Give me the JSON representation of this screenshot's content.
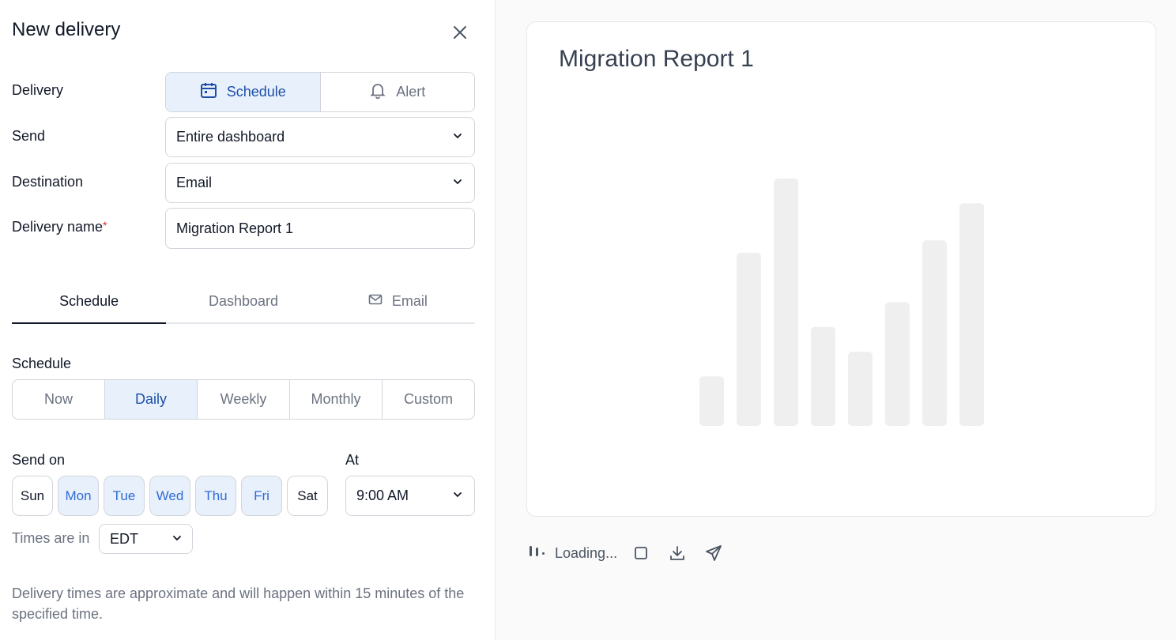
{
  "panel": {
    "title": "New delivery",
    "close_icon": "close-icon"
  },
  "form": {
    "delivery_label": "Delivery",
    "delivery_options": [
      {
        "label": "Schedule",
        "icon": "calendar-icon",
        "active": true
      },
      {
        "label": "Alert",
        "icon": "bell-icon",
        "active": false
      }
    ],
    "send_label": "Send",
    "send_value": "Entire dashboard",
    "destination_label": "Destination",
    "destination_value": "Email",
    "name_label": "Delivery name",
    "name_required_mark": "*",
    "name_value": "Migration Report 1"
  },
  "tabs": [
    {
      "label": "Schedule",
      "active": true
    },
    {
      "label": "Dashboard",
      "active": false
    },
    {
      "label": "Email",
      "icon": "mail-icon",
      "active": false
    }
  ],
  "schedule": {
    "label": "Schedule",
    "frequencies": [
      {
        "label": "Now",
        "active": false
      },
      {
        "label": "Daily",
        "active": true
      },
      {
        "label": "Weekly",
        "active": false
      },
      {
        "label": "Monthly",
        "active": false
      },
      {
        "label": "Custom",
        "active": false
      }
    ],
    "send_on_label": "Send on",
    "days": [
      {
        "label": "Sun",
        "on": false
      },
      {
        "label": "Mon",
        "on": true
      },
      {
        "label": "Tue",
        "on": true
      },
      {
        "label": "Wed",
        "on": true
      },
      {
        "label": "Thu",
        "on": true
      },
      {
        "label": "Fri",
        "on": true
      },
      {
        "label": "Sat",
        "on": false
      }
    ],
    "at_label": "At",
    "time_value": "9:00 AM",
    "timezone_label": "Times are in",
    "timezone_value": "EDT",
    "note": "Delivery times are approximate and will happen within 15 minutes of the specified time."
  },
  "preview": {
    "title": "Migration Report 1",
    "loading_text": "Loading...",
    "placeholder_bars": [
      0.2,
      0.7,
      1.0,
      0.4,
      0.3,
      0.5,
      0.75,
      0.9
    ],
    "toolbar_icons": [
      "loading-spinner-icon",
      "stop-icon",
      "download-icon",
      "send-icon"
    ]
  },
  "colors": {
    "accent": "#1e4fa8",
    "accent_bg": "#e8f1fb",
    "placeholder_bar": "#efefef"
  }
}
